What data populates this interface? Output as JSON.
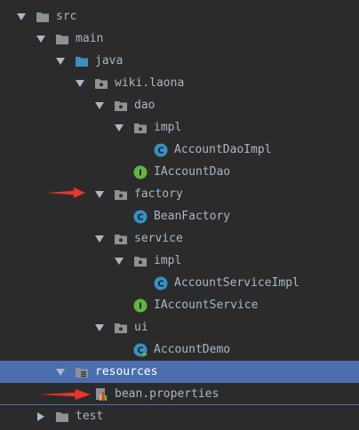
{
  "tree": {
    "src": "src",
    "main": "main",
    "java": "java",
    "pkg": "wiki.laona",
    "dao": "dao",
    "dao_impl": "impl",
    "account_dao_impl": "AccountDaoImpl",
    "iaccount_dao": "IAccountDao",
    "factory": "factory",
    "bean_factory": "BeanFactory",
    "service": "service",
    "service_impl": "impl",
    "account_service_impl": "AccountServiceImpl",
    "iaccount_service": "IAccountService",
    "ui": "ui",
    "account_demo": "AccountDemo",
    "resources": "resources",
    "bean_properties": "bean.properties",
    "test": "test"
  },
  "icons": {
    "class_badge": "C",
    "interface_badge": "I"
  },
  "colors": {
    "background": "#2b2b2b",
    "text": "#a9b7c6",
    "selection": "#4b6eaf",
    "folder": "#8c9296",
    "source_folder": "#3d8fbf",
    "class_icon": "#3592c4",
    "interface_icon": "#62b543",
    "annotation_arrow": "#e8352b"
  }
}
